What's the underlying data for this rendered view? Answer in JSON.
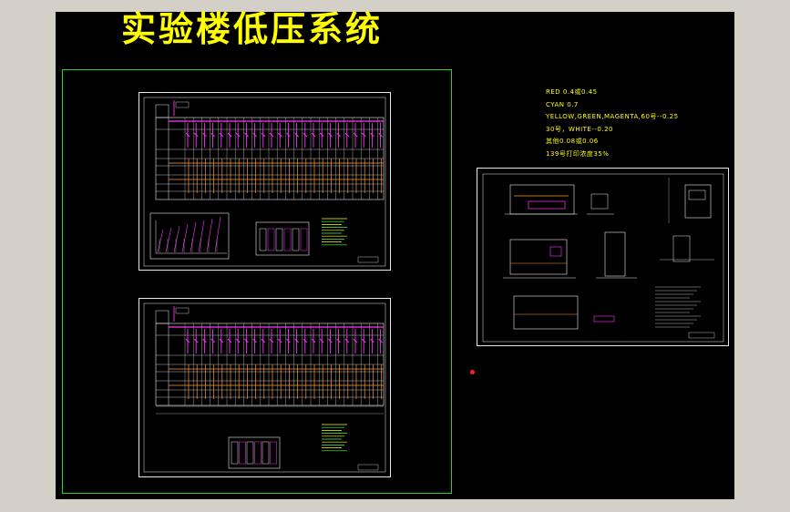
{
  "drawing": {
    "title": "实验楼低压系统"
  },
  "pen_notes": [
    "RED 0.4或0.45",
    "CYAN 0.7",
    "YELLOW,GREEN,MAGENTA,60号--0.25",
    "30号，WHITE--0.20",
    "其他0.08或0.06",
    "139号打印浓度35%"
  ],
  "colors": {
    "background": "#000000",
    "frame": "#2ecc2e",
    "title": "#ffff00",
    "magenta": "#ff33ff",
    "orange": "#ff9933",
    "line": "#e8e8e8",
    "marker": "#ff2020"
  }
}
